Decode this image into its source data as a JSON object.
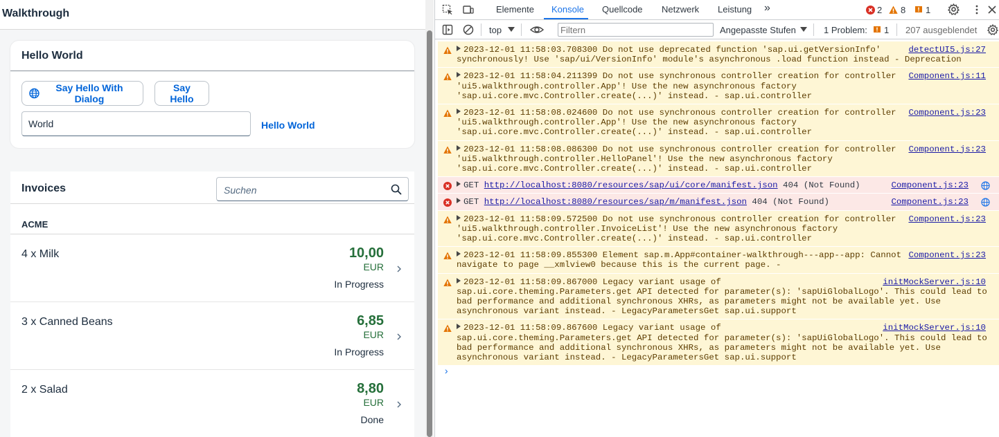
{
  "app": {
    "title": "Walkthrough",
    "hello_panel": {
      "title": "Hello World",
      "dialog_button": "Say Hello With Dialog",
      "hello_button": "Say Hello",
      "input_value": "World",
      "output_text": "Hello World"
    },
    "invoices": {
      "title": "Invoices",
      "search_placeholder": "Suchen",
      "group": "ACME",
      "items": [
        {
          "name": "4 x Milk",
          "amount": "10,00",
          "currency": "EUR",
          "status": "In Progress"
        },
        {
          "name": "3 x Canned Beans",
          "amount": "6,85",
          "currency": "EUR",
          "status": "In Progress"
        },
        {
          "name": "2 x Salad",
          "amount": "8,80",
          "currency": "EUR",
          "status": "Done"
        }
      ]
    }
  },
  "devtools": {
    "tabs": [
      "Elemente",
      "Konsole",
      "Quellcode",
      "Netzwerk",
      "Leistung"
    ],
    "active_tab": "Konsole",
    "more_tabs": "»",
    "error_count": "2",
    "warning_count": "8",
    "issue_count": "1",
    "context": "top",
    "filter_placeholder": "Filtern",
    "levels": "Angepasste Stufen",
    "problems_label": "1 Problem:",
    "problems_count": "1",
    "hidden_count": "207 ausgeblendet",
    "messages": [
      {
        "level": "warn",
        "text": "2023-12-01 11:58:03.708300 Do not use deprecated function 'sap.ui.getVersionInfo'\nsynchronously! Use 'sap/ui/VersionInfo' module's asynchronous .load function instead - Deprecation",
        "source": "detectUI5.js:27"
      },
      {
        "level": "warn",
        "text": "2023-12-01 11:58:04.211399 Do not use synchronous controller creation for controller\n'ui5.walkthrough.controller.App'! Use the new asynchronous factory\n'sap.ui.core.mvc.Controller.create(...)' instead. - sap.ui.controller",
        "source": "Component.js:11"
      },
      {
        "level": "warn",
        "text": "2023-12-01 11:58:08.024600 Do not use synchronous controller creation for controller\n'ui5.walkthrough.controller.App'! Use the new asynchronous factory\n'sap.ui.core.mvc.Controller.create(...)' instead. - sap.ui.controller",
        "source": "Component.js:23"
      },
      {
        "level": "warn",
        "text": "2023-12-01 11:58:08.086300 Do not use synchronous controller creation for controller\n'ui5.walkthrough.controller.HelloPanel'! Use the new asynchronous factory\n'sap.ui.core.mvc.Controller.create(...)' instead. - sap.ui.controller",
        "source": "Component.js:23"
      },
      {
        "level": "error",
        "method": "GET",
        "url": "http://localhost:8080/resources/sap/ui/core/manifest.json",
        "status": "404 (Not Found)",
        "source": "Component.js:23"
      },
      {
        "level": "error",
        "method": "GET",
        "url": "http://localhost:8080/resources/sap/m/manifest.json",
        "status": "404 (Not Found)",
        "source": "Component.js:23"
      },
      {
        "level": "warn",
        "text": "2023-12-01 11:58:09.572500 Do not use synchronous controller creation for controller\n'ui5.walkthrough.controller.InvoiceList'! Use the new asynchronous factory\n'sap.ui.core.mvc.Controller.create(...)' instead. - sap.ui.controller",
        "source": "Component.js:23"
      },
      {
        "level": "warn",
        "text": "2023-12-01 11:58:09.855300 Element sap.m.App#container-walkthrough---app--app: Cannot\nnavigate to page __xmlview0 because this is the current page. -",
        "source": "Component.js:23"
      },
      {
        "level": "warn",
        "text": "2023-12-01 11:58:09.867000 Legacy variant usage of\nsap.ui.core.theming.Parameters.get API detected for parameter(s): 'sapUiGlobalLogo'. This could lead to\nbad performance and additional synchronous XHRs, as parameters might not be available yet. Use\nasynchronous variant instead. - LegacyParametersGet sap.ui.support",
        "source": "initMockServer.js:10"
      },
      {
        "level": "warn",
        "text": "2023-12-01 11:58:09.867600 Legacy variant usage of\nsap.ui.core.theming.Parameters.get API detected for parameter(s): 'sapUiGlobalLogo'. This could lead to\nbad performance and additional synchronous XHRs, as parameters might not be available yet. Use\nasynchronous variant instead. - LegacyParametersGet sap.ui.support",
        "source": "initMockServer.js:10"
      }
    ],
    "prompt": "›"
  }
}
